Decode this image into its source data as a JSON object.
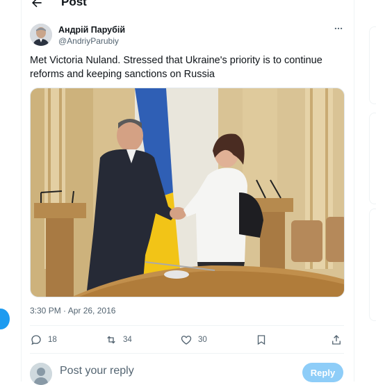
{
  "header": {
    "title": "Post"
  },
  "tweet": {
    "author_name": "Андрій Парубій",
    "author_handle": "@AndriyParubiy",
    "text": "Met Victoria Nuland. Stressed that Ukraine's priority is to continue reforms and keeping sanctions on Russia",
    "timestamp": "3:30 PM · Apr 26, 2016"
  },
  "actions": {
    "replies": "18",
    "reposts": "34",
    "likes": "30"
  },
  "reply_box": {
    "placeholder": "Post your reply",
    "button_label": "Reply"
  },
  "colors": {
    "accent": "#1d9bf0",
    "reply_button_disabled": "#8ecdf8",
    "secondary_text": "#536471",
    "flag_blue": "#2f5fb5",
    "flag_yellow": "#f2c417"
  }
}
